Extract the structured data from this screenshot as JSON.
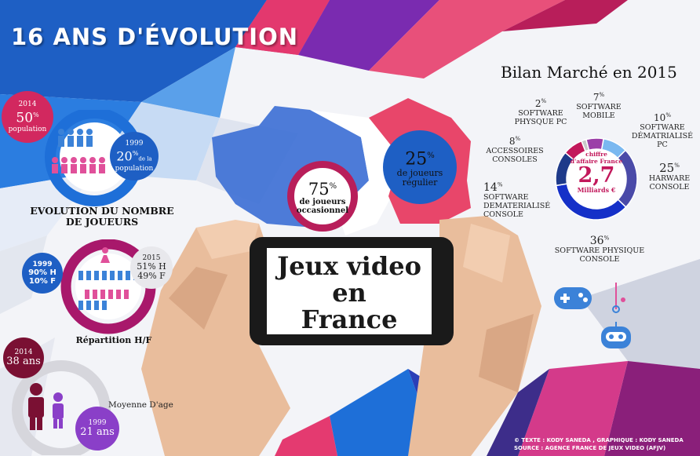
{
  "header": {
    "title": "16 ANS  D'ÉVOLUTION"
  },
  "players": {
    "y2014": {
      "year": "2014",
      "value": "50",
      "unit": "%",
      "label": "population"
    },
    "y1999": {
      "year": "1999",
      "value": "20",
      "unit": "%",
      "sub": "de la",
      "label": "population"
    },
    "caption_line1": "EVOLUTION DU NOMBRE",
    "caption_line2": "DE JOUEURS"
  },
  "gender": {
    "y1999": {
      "year": "1999",
      "h": "90% H",
      "f": "10% F"
    },
    "y2015": {
      "year": "2015",
      "h": "51% H",
      "f": "49% F"
    },
    "caption": "Répartition H/F"
  },
  "age": {
    "y2014": {
      "year": "2014",
      "value": "38 ans"
    },
    "y1999": {
      "year": "1999",
      "value": "21 ans"
    },
    "caption": "Moyenne D'age"
  },
  "center": {
    "occasional": {
      "value": "75",
      "unit": "%",
      "label1": "de joueurs",
      "label2": "occasionnel"
    },
    "regular": {
      "value": "25",
      "unit": "%",
      "label1": "de joueurs",
      "label2": "régulier"
    },
    "phone": {
      "line1": "Jeux video",
      "line2": "en",
      "line3": "France"
    }
  },
  "market": {
    "title": "Bilan Marché en 2015",
    "total_label1": "chiffre",
    "total_label2": "d'affaire France",
    "total_value": "2,7",
    "total_unit": "Milliards €",
    "segments": [
      {
        "value": "2",
        "unit": "%",
        "label1": "SOFTWARE",
        "label2": "PHYSQUE PC",
        "label3": "",
        "color": "#c8c8c8"
      },
      {
        "value": "7",
        "unit": "%",
        "label1": "SOFTWARE",
        "label2": "MOBILE",
        "label3": "",
        "color": "#9b3fa8"
      },
      {
        "value": "10",
        "unit": "%",
        "label1": "SOFTWARE",
        "label2": "DÉMATRIALISÉ",
        "label3": "PC",
        "color": "#7ab8f0"
      },
      {
        "value": "8",
        "unit": "%",
        "label1": "ACCESSOIRES",
        "label2": "CONSOLES",
        "label3": "",
        "color": "#c2185b"
      },
      {
        "value": "25",
        "unit": "%",
        "label1": "HARWARE",
        "label2": "CONSOLE",
        "label3": "",
        "color": "#4a4aa8"
      },
      {
        "value": "14",
        "unit": "%",
        "label1": "SOFTWARE",
        "label2": "DEMATERIALISÉ",
        "label3": "CONSOLE",
        "color": "#1e3a8a"
      },
      {
        "value": "36",
        "unit": "%",
        "label1": "SOFTWARE PHYSIQUE",
        "label2": "CONSOLE",
        "label3": "",
        "color": "#1530c8"
      }
    ]
  },
  "credits": {
    "line1": "© TEXTE : KODY SANEDA , GRAPHIQUE : KODY SANEDA",
    "line2": "SOURCE : AGENCE FRANCE DE JEUX VIDEO (AFJV)"
  },
  "colors": {
    "accent_pink": "#c2185b",
    "accent_blue": "#1565c0",
    "accent_purple": "#7b1fa2"
  }
}
